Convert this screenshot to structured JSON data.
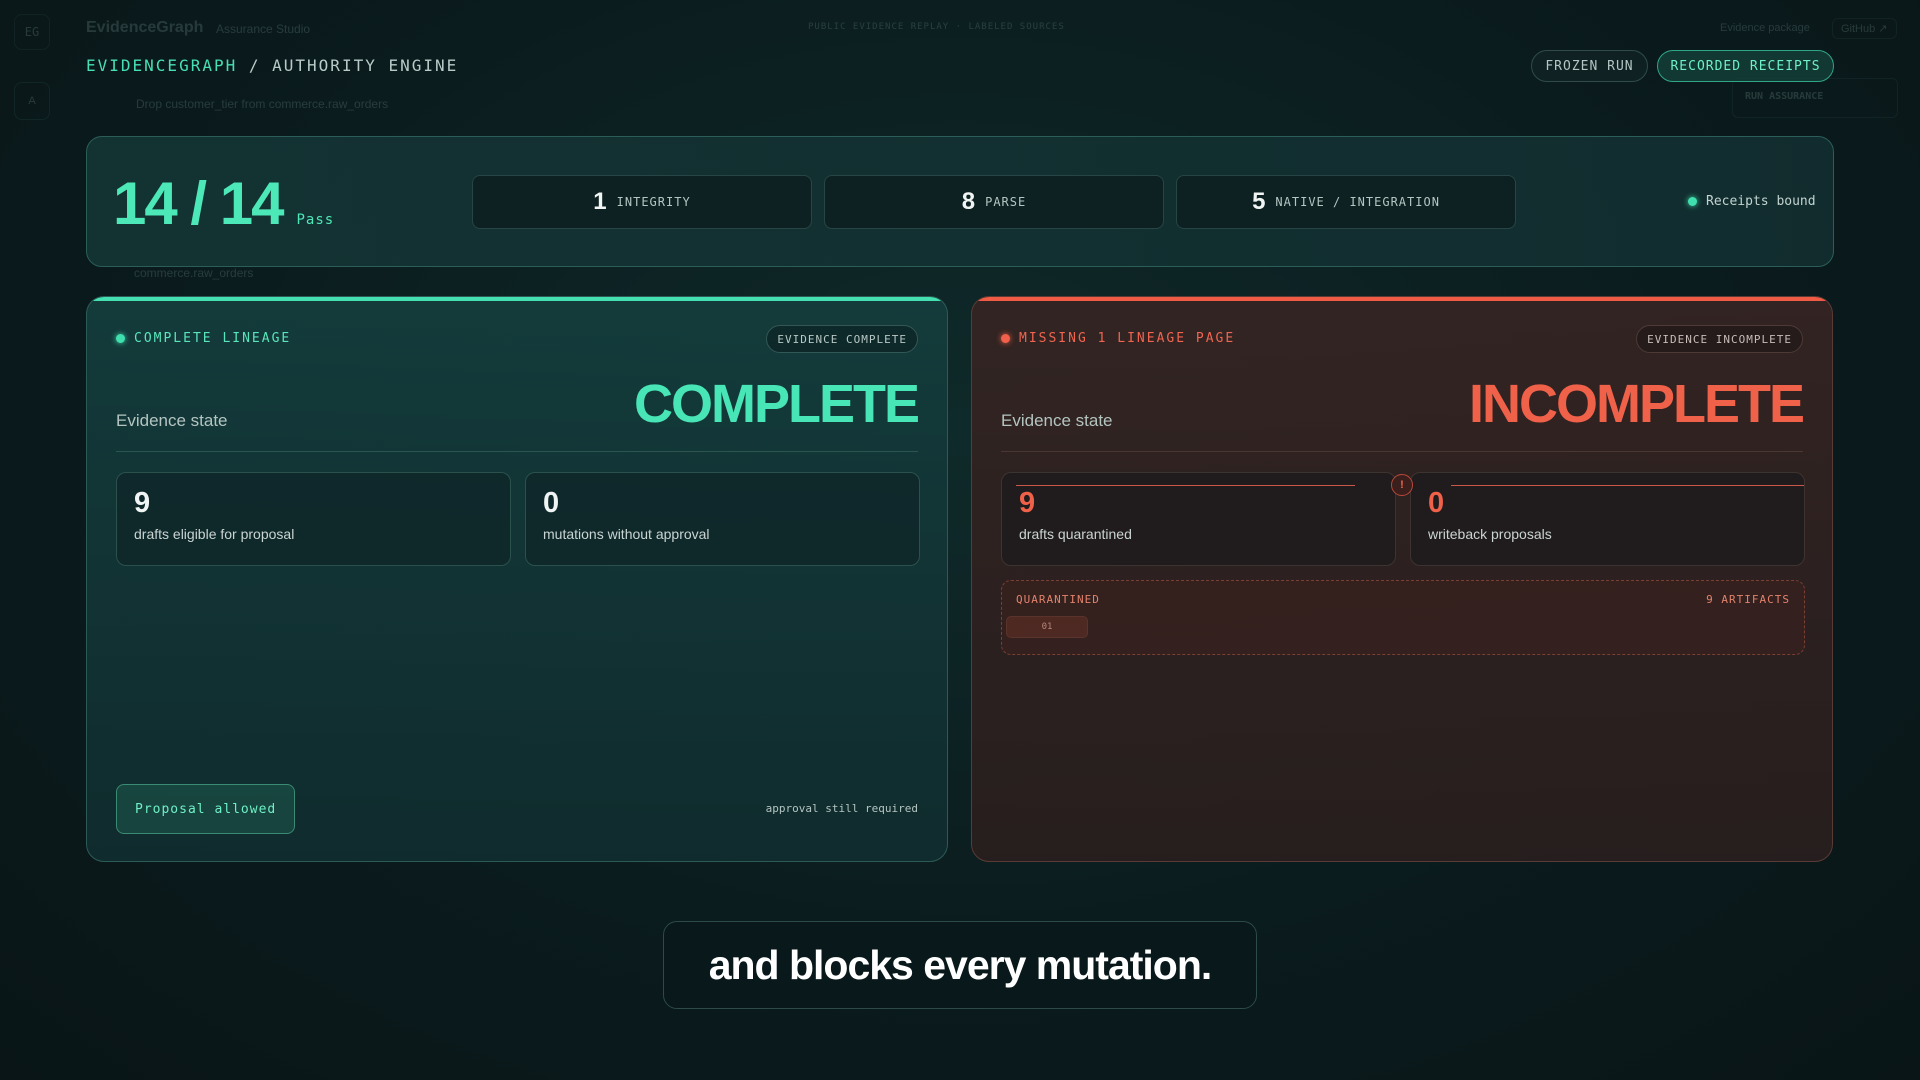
{
  "background_chrome": {
    "logo_initials": "EG",
    "brand": "EvidenceGraph",
    "subtitle": "Assurance Studio",
    "nav_text": "PUBLIC EVIDENCE REPLAY · LABELED SOURCES",
    "evidence_package": "Evidence package",
    "github": "GitHub ↗",
    "side_item": "A",
    "drop_text": "Drop customer_tier from commerce.raw_orders",
    "run_assurance": "RUN ASSURANCE",
    "raw_orders": "commerce.raw_orders"
  },
  "header": {
    "brand": "EVIDENCEGRAPH",
    "separator": " / ",
    "section": "AUTHORITY ENGINE",
    "frozen_run": "FROZEN RUN",
    "recorded_receipts": "RECORDED RECEIPTS"
  },
  "summary": {
    "score": "14 / 14",
    "pass_label": "Pass",
    "stats": [
      {
        "num": "1",
        "label": "INTEGRITY"
      },
      {
        "num": "8",
        "label": "PARSE"
      },
      {
        "num": "5",
        "label": "NATIVE / INTEGRATION"
      }
    ],
    "receipts_bound": "Receipts bound"
  },
  "complete_card": {
    "lineage": "COMPLETE LINEAGE",
    "badge": "EVIDENCE COMPLETE",
    "state_label": "Evidence state",
    "state_value": "COMPLETE",
    "metrics": [
      {
        "num": "9",
        "label": "drafts eligible for proposal"
      },
      {
        "num": "0",
        "label": "mutations without approval"
      }
    ],
    "proposal_button": "Proposal allowed",
    "approval_note": "approval still required"
  },
  "incomplete_card": {
    "lineage": "MISSING 1 LINEAGE PAGE",
    "badge": "EVIDENCE INCOMPLETE",
    "state_label": "Evidence state",
    "state_value": "INCOMPLETE",
    "alert": "!",
    "metrics": [
      {
        "num": "9",
        "label": "drafts quarantined"
      },
      {
        "num": "0",
        "label": "writeback proposals"
      }
    ],
    "quarantine_label": "QUARANTINED",
    "quarantine_count": "9 ARTIFACTS",
    "quarantine_chip": "01"
  },
  "caption": "and blocks every mutation.",
  "colors": {
    "accent_green": "#46e0b4",
    "accent_red": "#f0614a",
    "background": "#0b1c1e"
  }
}
